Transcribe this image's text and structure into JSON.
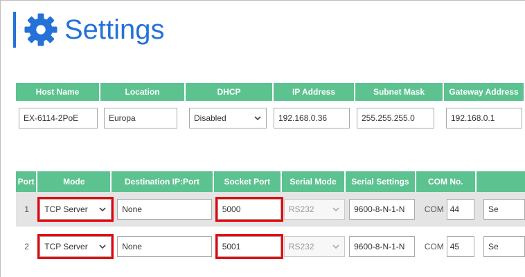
{
  "page": {
    "title": "Settings"
  },
  "network": {
    "headers": [
      "Host Name",
      "Location",
      "DHCP",
      "IP Address",
      "Subnet Mask",
      "Gateway Address"
    ],
    "host_name": "EX-6114-2PoE",
    "location": "Europa",
    "dhcp": "Disabled",
    "ip_address": "192.168.0.36",
    "subnet_mask": "255.255.255.0",
    "gateway": "192.168.0.1"
  },
  "ports": {
    "headers": [
      "Port",
      "Mode",
      "Destination IP:Port",
      "Socket Port",
      "Serial Mode",
      "Serial Settings",
      "COM No.",
      ""
    ],
    "rows": [
      {
        "port": "1",
        "mode": "TCP Server",
        "destination": "None",
        "socket_port": "5000",
        "serial_mode": "RS232",
        "serial_settings": "9600-8-N-1-N",
        "com_prefix": "COM",
        "com_no": "44",
        "extra": "Se"
      },
      {
        "port": "2",
        "mode": "TCP Server",
        "destination": "None",
        "socket_port": "5001",
        "serial_mode": "RS232",
        "serial_settings": "9600-8-N-1-N",
        "com_prefix": "COM",
        "com_no": "45",
        "extra": "Se"
      }
    ]
  },
  "colors": {
    "accent": "#2472d8",
    "header_bg": "#5cc28f",
    "highlight": "#e8000a",
    "row_shade": "#e4e4e4"
  }
}
